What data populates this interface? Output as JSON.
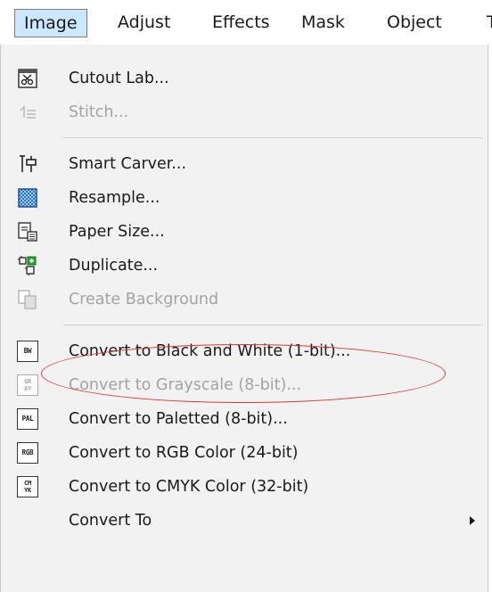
{
  "menubar": {
    "items": [
      {
        "label": "Image",
        "active": true
      },
      {
        "label": "Adjust",
        "active": false
      },
      {
        "label": "Effects",
        "active": false
      },
      {
        "label": "Mask",
        "active": false
      },
      {
        "label": "Object",
        "active": false
      }
    ]
  },
  "menu": {
    "items": [
      {
        "label": "Cutout Lab...",
        "icon": "cutout-lab-icon",
        "enabled": true
      },
      {
        "label": "Stitch...",
        "icon": "stitch-icon",
        "enabled": false
      },
      {
        "label": "Smart Carver...",
        "icon": "smart-carver-icon",
        "enabled": true
      },
      {
        "label": "Resample...",
        "icon": "resample-icon",
        "enabled": true
      },
      {
        "label": "Paper Size...",
        "icon": "paper-size-icon",
        "enabled": true
      },
      {
        "label": "Duplicate...",
        "icon": "duplicate-icon",
        "enabled": true
      },
      {
        "label": "Create Background",
        "icon": "create-background-icon",
        "enabled": false
      },
      {
        "label": "Convert to Black and White (1-bit)...",
        "icon": "black-white-icon",
        "icon_text": "BW",
        "enabled": true
      },
      {
        "label": "Convert to Grayscale (8-bit)...",
        "icon": "grayscale-icon",
        "icon_text": [
          "GR",
          "AY"
        ],
        "enabled": false
      },
      {
        "label": "Convert to Paletted (8-bit)...",
        "icon": "paletted-icon",
        "icon_text": "PAL",
        "enabled": true
      },
      {
        "label": "Convert to RGB Color (24-bit)",
        "icon": "rgb-icon",
        "icon_text": "RGB",
        "enabled": true
      },
      {
        "label": "Convert to CMYK Color (32-bit)",
        "icon": "cmyk-icon",
        "icon_text": [
          "CM",
          "YK"
        ],
        "enabled": true
      },
      {
        "label": "Convert To",
        "icon": "submenu-arrow-icon",
        "enabled": true
      }
    ]
  },
  "colors": {
    "menu_background": "#f2f2f2",
    "active_tab": "#cce8ff",
    "disabled_text": "#a3a3a3",
    "annotation": "#e03535"
  }
}
